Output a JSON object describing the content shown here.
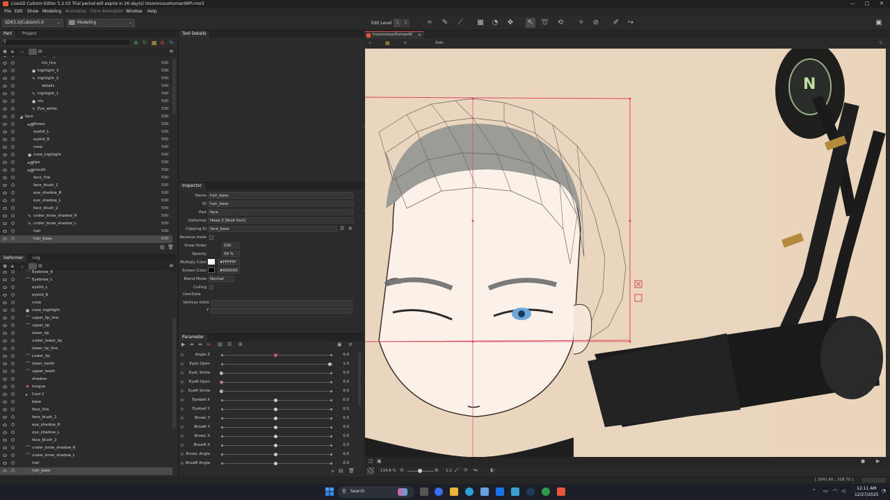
{
  "window": {
    "title": "Live2D Cubism Editor 5.2.03   Trial period will expire in 26 day(s)   InsomniousHumanWIP.cmo3",
    "minimize": "—",
    "maximize": "□",
    "close": "✕"
  },
  "menu": [
    "File",
    "Edit",
    "Show",
    "Modeling",
    "Animation",
    "Form Animation",
    "Window",
    "Help"
  ],
  "toolbar": {
    "sdk": "SDK5.0/Cubism5.0",
    "mode": "Modeling",
    "edit_level": "Edit Level",
    "level_1": "1",
    "level_2": "2"
  },
  "part_panel": {
    "tabs": [
      "Part",
      "Project"
    ],
    "rows": [
      {
        "name": "eyelid_shadow",
        "val": ""
      },
      {
        "name": "iris_line",
        "val": "500"
      },
      {
        "name": "highlight_3",
        "val": "500"
      },
      {
        "name": "highlight_2",
        "val": "500"
      },
      {
        "name": "details",
        "val": "500"
      },
      {
        "name": "highlight_1",
        "val": "500"
      },
      {
        "name": "iris",
        "val": "500"
      },
      {
        "name": "Eye_white",
        "val": "500"
      },
      {
        "name": "face",
        "val": "500"
      },
      {
        "name": "Brows",
        "val": "500"
      },
      {
        "name": "eyelid_L",
        "val": "500"
      },
      {
        "name": "eyelid_R",
        "val": "500"
      },
      {
        "name": "nose",
        "val": "500"
      },
      {
        "name": "nose_highlight",
        "val": "500"
      },
      {
        "name": "lips",
        "val": "500"
      },
      {
        "name": "mouth",
        "val": "500"
      },
      {
        "name": "face_line",
        "val": "500"
      },
      {
        "name": "face_blush_1",
        "val": "500"
      },
      {
        "name": "eye_shadow_R",
        "val": "500"
      },
      {
        "name": "eye_shadow_L",
        "val": "500"
      },
      {
        "name": "face_blush_2",
        "val": "500"
      },
      {
        "name": "under_brow_shadow_R",
        "val": "500"
      },
      {
        "name": "under_brow_shadow_L",
        "val": "500"
      },
      {
        "name": "hair",
        "val": "500"
      },
      {
        "name": "hair_base",
        "val": "500"
      }
    ]
  },
  "deformer_panel": {
    "tabs": [
      "Deformer",
      "Log"
    ],
    "rows": [
      "Eyebrow_R",
      "Eyebrow_L",
      "eyelid_L",
      "eyelid_R",
      "nose",
      "nose_highlight",
      "upper_lip_line",
      "upper_lip",
      "lower_lip",
      "under_lower_lip",
      "lower_lip_line",
      "Lower_lip",
      "lower_teeth",
      "upper_teeth",
      "shadow",
      "tongue",
      "Cool 2",
      "base",
      "face_line",
      "face_blush_1",
      "eye_shadow_R",
      "eye_shadow_L",
      "face_blush_2",
      "under_brow_shadow_R",
      "under_brow_shadow_L",
      "hair",
      "hair_base"
    ]
  },
  "tool_details": {
    "title": "Tool Details"
  },
  "inspector": {
    "title": "Inspector",
    "name_label": "Name",
    "name": "hair_base",
    "id_label": "ID",
    "id": "hair_base",
    "part_label": "Part",
    "part": "face",
    "deformer_label": "Deformer",
    "deformer": "Head Z [Root Part]",
    "clip_label": "Clipping ID",
    "clip": "face_base",
    "reverse_label": "Reverse mask",
    "draw_label": "Draw Order",
    "draw": "500",
    "opacity_label": "Opacity",
    "opacity": "56 %",
    "multiply_label": "Multiply Color",
    "multiply": "#FFFFFF",
    "screen_label": "Screen Color",
    "screen": "#000000",
    "blend_label": "Blend Mode",
    "blend": "Normal",
    "culling_label": "Culling",
    "userdata_label": "UserData",
    "vertices_label": "Vertices Info",
    "vx": "X",
    "vy": "Y"
  },
  "parameters": {
    "title": "Parameter",
    "rows": [
      {
        "name": "Angle Z",
        "value": "0.0",
        "pos": 0.5,
        "red": true
      },
      {
        "name": "EyeL Open",
        "value": "1.0",
        "pos": 1.0,
        "red": false
      },
      {
        "name": "EyeL Smile",
        "value": "0.0",
        "pos": 0.0,
        "red": false
      },
      {
        "name": "EyeR Open",
        "value": "0.0",
        "pos": 0.0,
        "red": true
      },
      {
        "name": "EyeR Smile",
        "value": "0.0",
        "pos": 0.0,
        "red": false
      },
      {
        "name": "Eyeball X",
        "value": "0.0",
        "pos": 0.5,
        "red": false
      },
      {
        "name": "Eyeball Y",
        "value": "0.0",
        "pos": 0.5,
        "red": false
      },
      {
        "name": "BrowL Y",
        "value": "0.0",
        "pos": 0.5,
        "red": false
      },
      {
        "name": "BrowR Y",
        "value": "0.0",
        "pos": 0.5,
        "red": false
      },
      {
        "name": "BrowL X",
        "value": "0.0",
        "pos": 0.5,
        "red": false
      },
      {
        "name": "BrowR X",
        "value": "0.0",
        "pos": 0.5,
        "red": false
      },
      {
        "name": "BrowL Angle",
        "value": "0.0",
        "pos": 0.5,
        "red": false
      },
      {
        "name": "BrowR Angle",
        "value": "0.0",
        "pos": 0.5,
        "red": false
      }
    ]
  },
  "canvas": {
    "doc_tab": "InsomniousHumanW",
    "solo": "Solo",
    "zoom": "114.8 %",
    "ratio": "1:1",
    "ruler": [
      "900",
      "800",
      "700",
      "600",
      "500",
      "400",
      "300",
      "200"
    ]
  },
  "status": {
    "coords": "[ 2001.60 , 318.70 ]",
    "time": "12:11 AM",
    "date": "12/27/2025"
  },
  "taskbar": {
    "search": "Search"
  },
  "colors": {
    "accent": "#d9475a",
    "mesh": "#6a5f57",
    "bg": "#2b2b2b"
  }
}
